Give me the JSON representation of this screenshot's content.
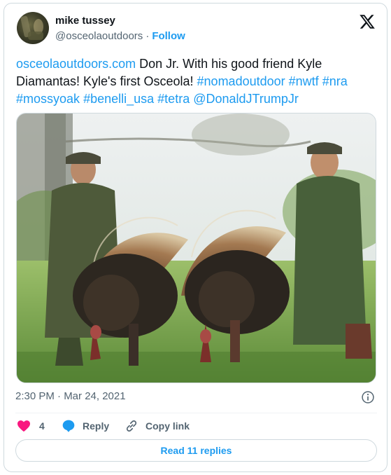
{
  "author": {
    "name": "mike tussey",
    "handle": "@osceolaoutdoors",
    "separator": "·",
    "follow_label": "Follow"
  },
  "tweet": {
    "parts": [
      {
        "text": "osceolaoutdoors.com",
        "link": true
      },
      {
        "text": " Don Jr. With his good friend Kyle Diamantas! Kyle's first Osceola! ",
        "link": false
      },
      {
        "text": "#nomadoutdoor",
        "link": true
      },
      {
        "text": " ",
        "link": false
      },
      {
        "text": "#nwtf",
        "link": true
      },
      {
        "text": " ",
        "link": false
      },
      {
        "text": "#nra",
        "link": true
      },
      {
        "text": " ",
        "link": false
      },
      {
        "text": "#mossyoak",
        "link": true
      },
      {
        "text": " ",
        "link": false
      },
      {
        "text": "#benelli_usa",
        "link": true
      },
      {
        "text": " ",
        "link": false
      },
      {
        "text": "#tetra",
        "link": true
      },
      {
        "text": " ",
        "link": false
      },
      {
        "text": "@DonaldJTrumpJr",
        "link": true
      }
    ]
  },
  "timestamp": "2:30 PM · Mar 24, 2021",
  "actions": {
    "like_count": "4",
    "reply_label": "Reply",
    "copy_label": "Copy link"
  },
  "read_replies_label": "Read 11 replies",
  "colors": {
    "accent": "#1d9bf0",
    "heart": "#f91880",
    "muted": "#536471",
    "text": "#0f1419"
  },
  "icons": [
    "x-logo-icon",
    "info-icon",
    "heart-icon",
    "reply-bubble-icon",
    "link-icon"
  ]
}
